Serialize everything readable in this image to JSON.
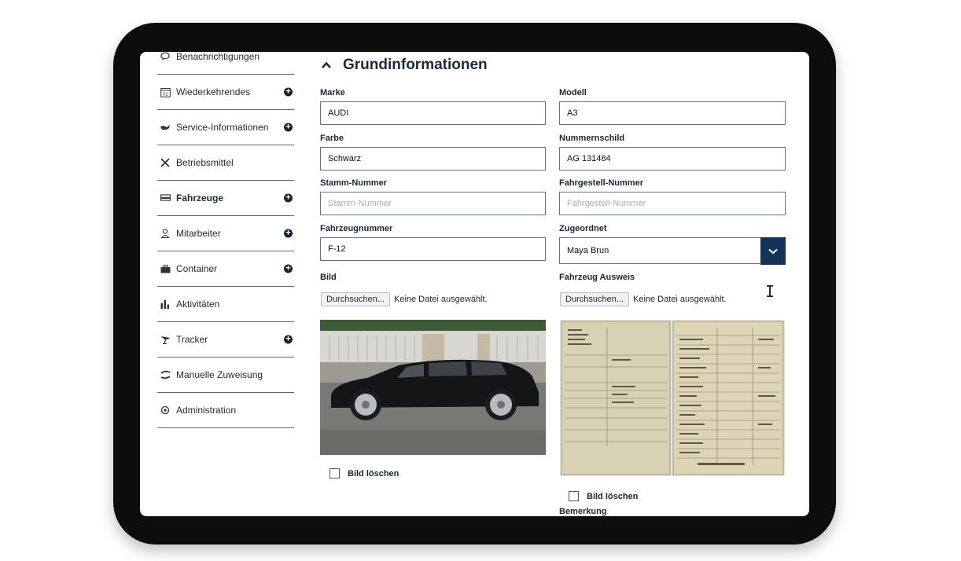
{
  "sidebar": {
    "items": [
      {
        "label": "Benachrichtigungen",
        "icon": "speech-bubble-icon",
        "has_add": false,
        "bold": false
      },
      {
        "label": "Wiederkehrendes",
        "icon": "calendar-icon",
        "has_add": true,
        "bold": false
      },
      {
        "label": "Service-Informationen",
        "icon": "oil-can-icon",
        "has_add": true,
        "bold": false
      },
      {
        "label": "Betriebsmittel",
        "icon": "tools-icon",
        "has_add": false,
        "bold": false
      },
      {
        "label": "Fahrzeuge",
        "icon": "vehicle-icon",
        "has_add": true,
        "bold": true
      },
      {
        "label": "Mitarbeiter",
        "icon": "person-icon",
        "has_add": true,
        "bold": false
      },
      {
        "label": "Container",
        "icon": "briefcase-icon",
        "has_add": true,
        "bold": false
      },
      {
        "label": "Aktivitäten",
        "icon": "bar-chart-icon",
        "has_add": false,
        "bold": false
      },
      {
        "label": "Tracker",
        "icon": "satellite-icon",
        "has_add": true,
        "bold": false
      },
      {
        "label": "Manuelle Zuweisung",
        "icon": "swap-icon",
        "has_add": false,
        "bold": false
      },
      {
        "label": "Administration",
        "icon": "gear-icon",
        "has_add": false,
        "bold": false
      }
    ],
    "calendar_day": "02",
    "add_symbol": "+"
  },
  "form": {
    "title": "Grundinformationen",
    "marke": {
      "label": "Marke",
      "value": "AUDI"
    },
    "modell": {
      "label": "Modell",
      "value": "A3"
    },
    "farbe": {
      "label": "Farbe",
      "value": "Schwarz"
    },
    "nummernschild": {
      "label": "Nummernschild",
      "value": "AG 131484"
    },
    "stamm": {
      "label": "Stamm-Nummer",
      "placeholder": "Stamm-Nummer"
    },
    "fahrgestell": {
      "label": "Fahrgestell-Nummer",
      "placeholder": "Fahrgestell-Nummer"
    },
    "fahrzeugnummer": {
      "label": "Fahrzeugnummer",
      "value": "F-12"
    },
    "zugeordnet": {
      "label": "Zugeordnet",
      "value": "Maya Brun"
    },
    "bild": {
      "label": "Bild",
      "browse": "Durchsuchen...",
      "no_file": "Keine Datei ausgewählt.",
      "delete_label": "Bild löschen"
    },
    "ausweis": {
      "label": "Fahrzeug Ausweis",
      "browse": "Durchsuchen...",
      "no_file": "Keine Datei ausgewählt.",
      "delete_label": "Bild löschen"
    },
    "bemerkung": {
      "label": "Bemerkung"
    }
  },
  "colors": {
    "accent": "#14335a",
    "device": "#0d0d0d",
    "text": "#1b2533"
  }
}
